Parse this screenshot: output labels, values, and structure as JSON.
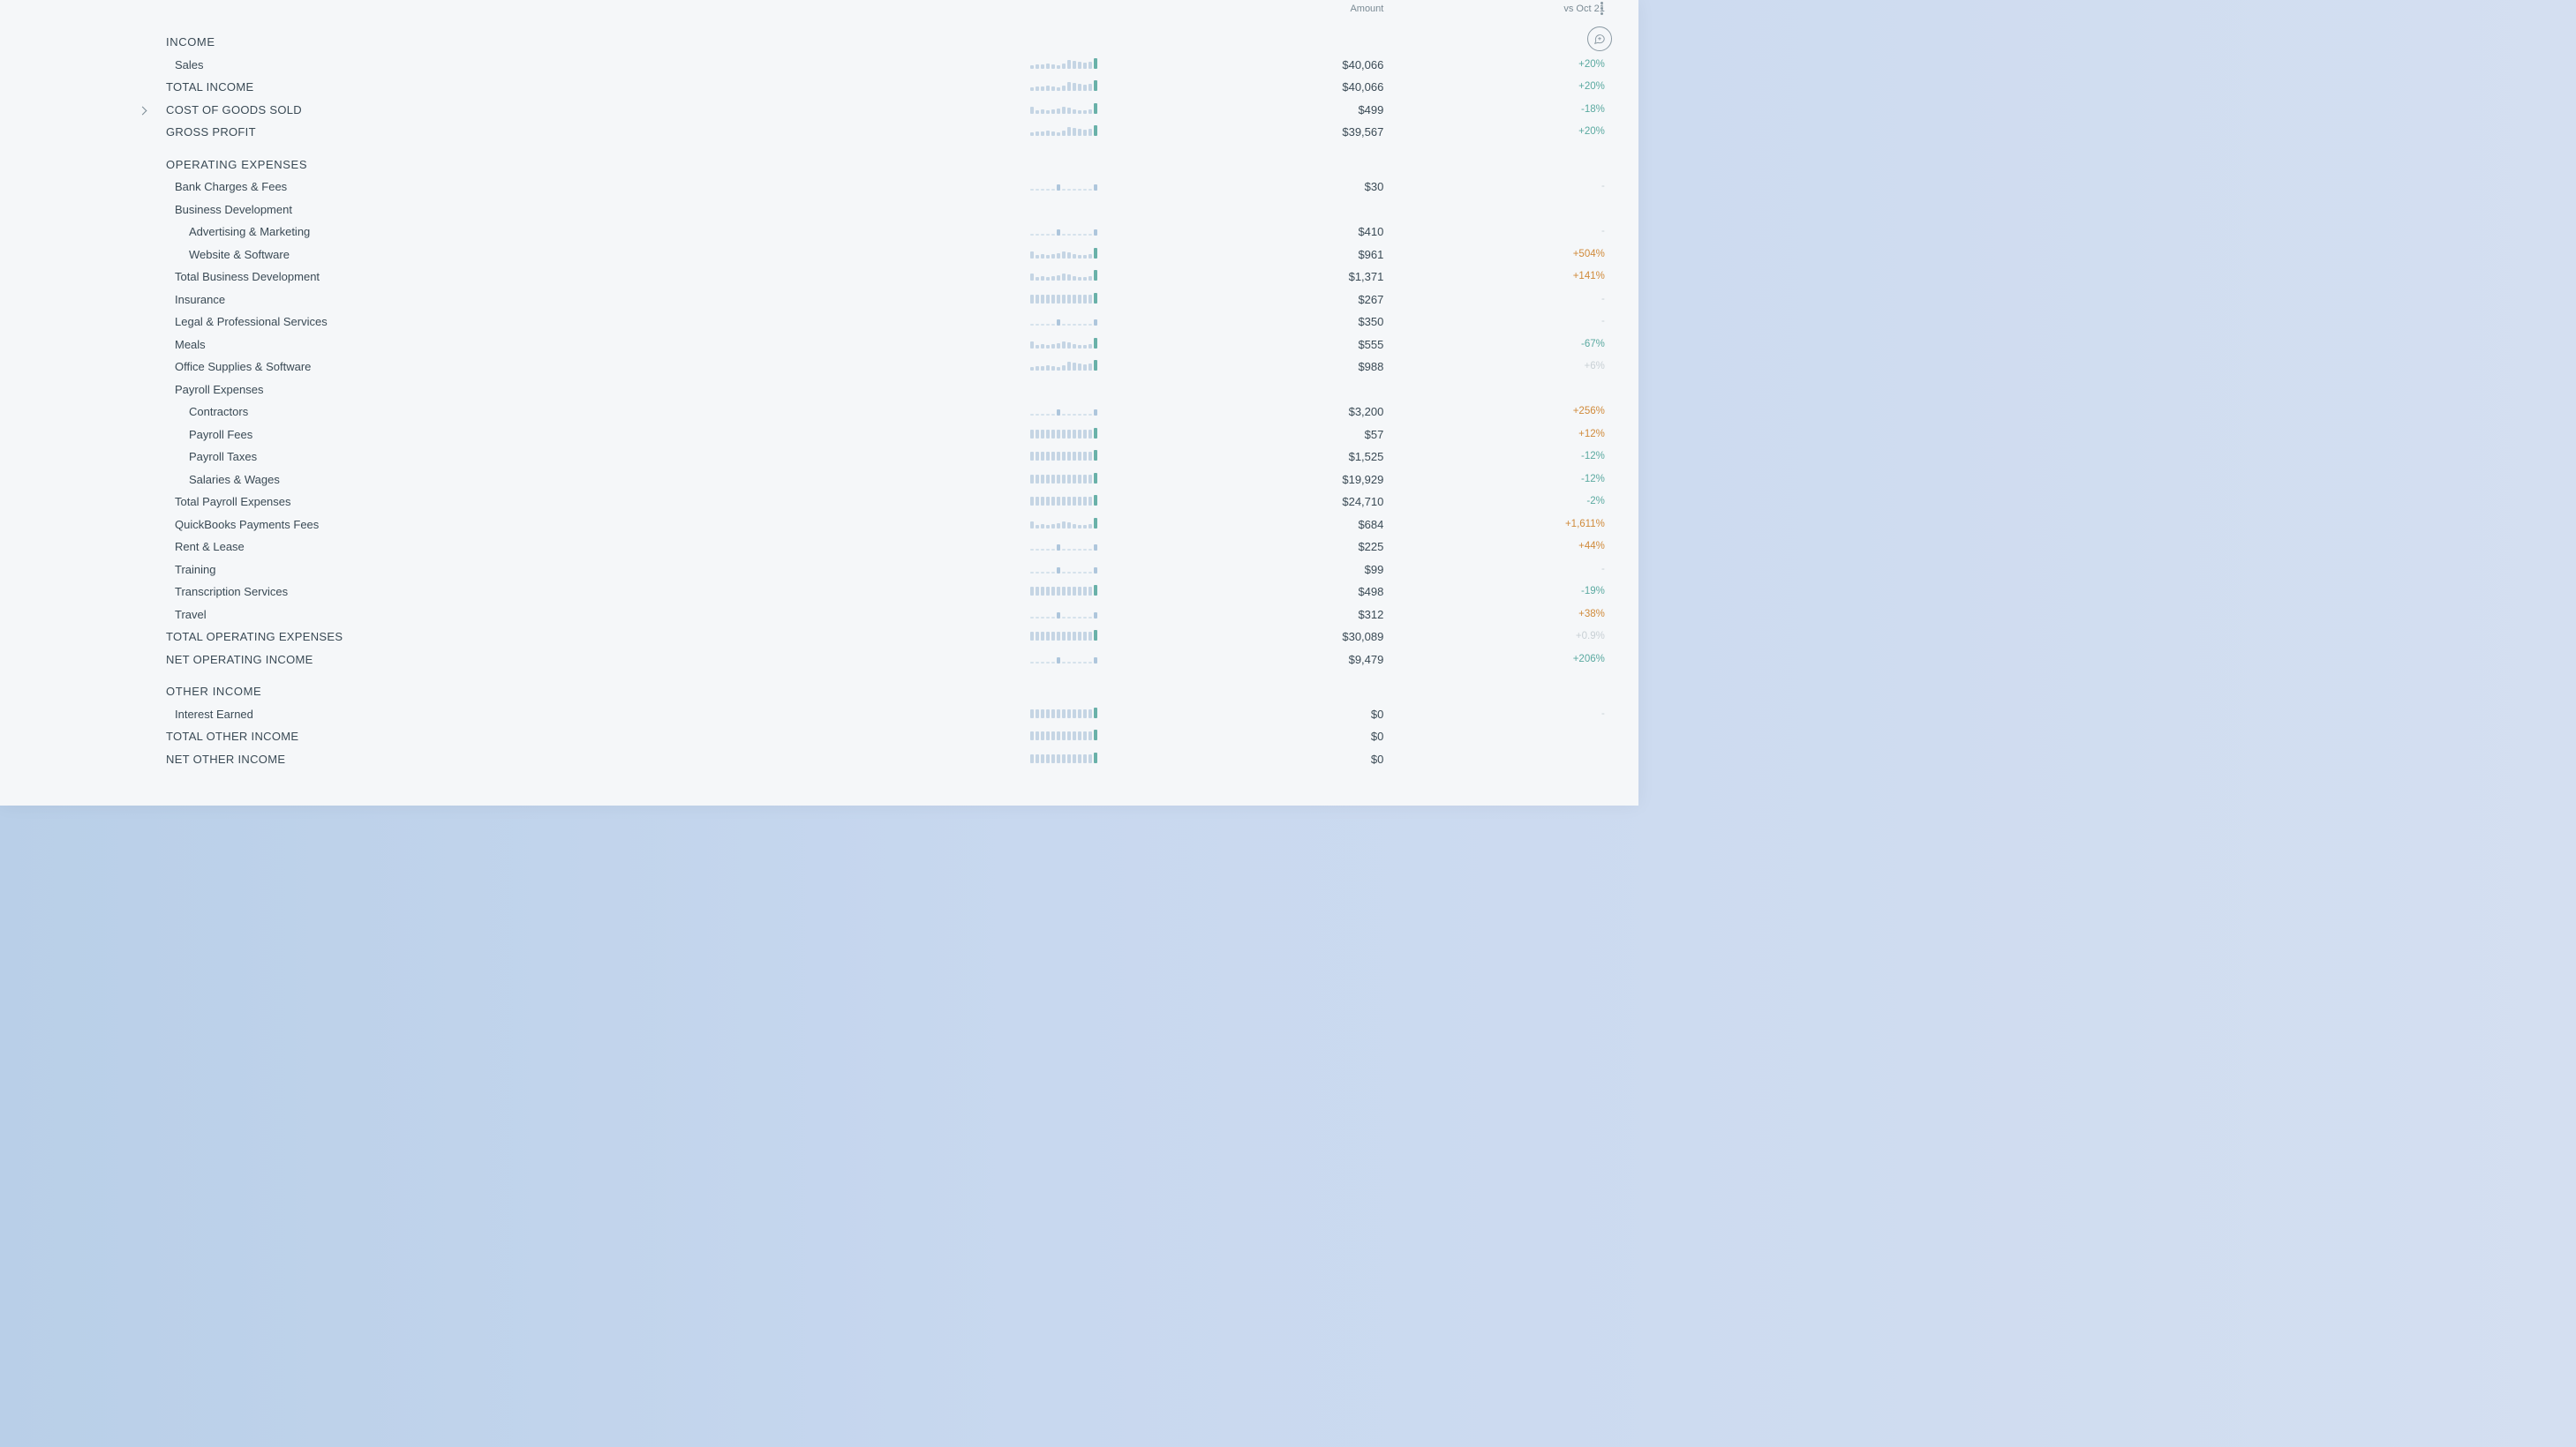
{
  "headers": {
    "amount": "Amount",
    "vs": "vs Oct 21"
  },
  "rows": [
    {
      "label": "INCOME",
      "type": "section"
    },
    {
      "label": "Sales",
      "indent": 1,
      "amount": "$40,066",
      "vs": "+20%",
      "cls": "pos",
      "spark": "A"
    },
    {
      "label": "TOTAL INCOME",
      "type": "total",
      "amount": "$40,066",
      "vs": "+20%",
      "cls": "pos",
      "spark": "A"
    },
    {
      "label": "COST OF GOODS SOLD",
      "type": "total",
      "amount": "$499",
      "vs": "-18%",
      "cls": "neg",
      "spark": "B",
      "caret": true
    },
    {
      "label": "GROSS PROFIT",
      "type": "total",
      "amount": "$39,567",
      "vs": "+20%",
      "cls": "pos",
      "spark": "A"
    },
    {
      "label": "OPERATING EXPENSES",
      "type": "section"
    },
    {
      "label": "Bank Charges & Fees",
      "indent": 1,
      "amount": "$30",
      "vs": "-",
      "cls": "faint",
      "spark": "D"
    },
    {
      "label": "Business Development",
      "indent": 1
    },
    {
      "label": "Advertising & Marketing",
      "indent": 2,
      "amount": "$410",
      "vs": "-",
      "cls": "faint",
      "spark": "D"
    },
    {
      "label": "Website & Software",
      "indent": 2,
      "amount": "$961",
      "vs": "+504%",
      "cls": "pos-orange",
      "spark": "B"
    },
    {
      "label": "Total Business Development",
      "indent": 1,
      "type": "subtotal",
      "amount": "$1,371",
      "vs": "+141%",
      "cls": "pos-orange",
      "spark": "B"
    },
    {
      "label": "Insurance",
      "indent": 1,
      "amount": "$267",
      "vs": "-",
      "cls": "faint",
      "spark": "F"
    },
    {
      "label": "Legal & Professional Services",
      "indent": 1,
      "amount": "$350",
      "vs": "-",
      "cls": "faint",
      "spark": "D"
    },
    {
      "label": "Meals",
      "indent": 1,
      "amount": "$555",
      "vs": "-67%",
      "cls": "neg",
      "spark": "B"
    },
    {
      "label": "Office Supplies & Software",
      "indent": 1,
      "amount": "$988",
      "vs": "+6%",
      "cls": "faint",
      "spark": "A"
    },
    {
      "label": "Payroll Expenses",
      "indent": 1
    },
    {
      "label": "Contractors",
      "indent": 2,
      "amount": "$3,200",
      "vs": "+256%",
      "cls": "pos-orange",
      "spark": "D"
    },
    {
      "label": "Payroll Fees",
      "indent": 2,
      "amount": "$57",
      "vs": "+12%",
      "cls": "pos-orange",
      "spark": "F"
    },
    {
      "label": "Payroll Taxes",
      "indent": 2,
      "amount": "$1,525",
      "vs": "-12%",
      "cls": "neg",
      "spark": "F"
    },
    {
      "label": "Salaries & Wages",
      "indent": 2,
      "amount": "$19,929",
      "vs": "-12%",
      "cls": "neg",
      "spark": "F"
    },
    {
      "label": "Total Payroll Expenses",
      "indent": 1,
      "type": "subtotal",
      "amount": "$24,710",
      "vs": "-2%",
      "cls": "neg",
      "spark": "F"
    },
    {
      "label": "QuickBooks Payments Fees",
      "indent": 1,
      "amount": "$684",
      "vs": "+1,611%",
      "cls": "pos-orange",
      "spark": "B"
    },
    {
      "label": "Rent & Lease",
      "indent": 1,
      "amount": "$225",
      "vs": "+44%",
      "cls": "pos-orange",
      "spark": "D"
    },
    {
      "label": "Training",
      "indent": 1,
      "amount": "$99",
      "vs": "-",
      "cls": "faint",
      "spark": "D"
    },
    {
      "label": "Transcription Services",
      "indent": 1,
      "amount": "$498",
      "vs": "-19%",
      "cls": "neg",
      "spark": "F"
    },
    {
      "label": "Travel",
      "indent": 1,
      "amount": "$312",
      "vs": "+38%",
      "cls": "pos-orange",
      "spark": "D"
    },
    {
      "label": "TOTAL OPERATING EXPENSES",
      "type": "total",
      "amount": "$30,089",
      "vs": "+0.9%",
      "cls": "faint",
      "spark": "F"
    },
    {
      "label": "NET OPERATING INCOME",
      "type": "total",
      "amount": "$9,479",
      "vs": "+206%",
      "cls": "pos",
      "spark": "D"
    },
    {
      "label": "OTHER INCOME",
      "type": "section"
    },
    {
      "label": "Interest Earned",
      "indent": 1,
      "amount": "$0",
      "vs": "-",
      "cls": "faint",
      "spark": "F"
    },
    {
      "label": "TOTAL OTHER INCOME",
      "type": "total",
      "amount": "$0",
      "vs": "",
      "spark": "F"
    },
    {
      "label": "NET OTHER INCOME",
      "type": "total",
      "amount": "$0",
      "vs": "",
      "spark": "F"
    }
  ]
}
